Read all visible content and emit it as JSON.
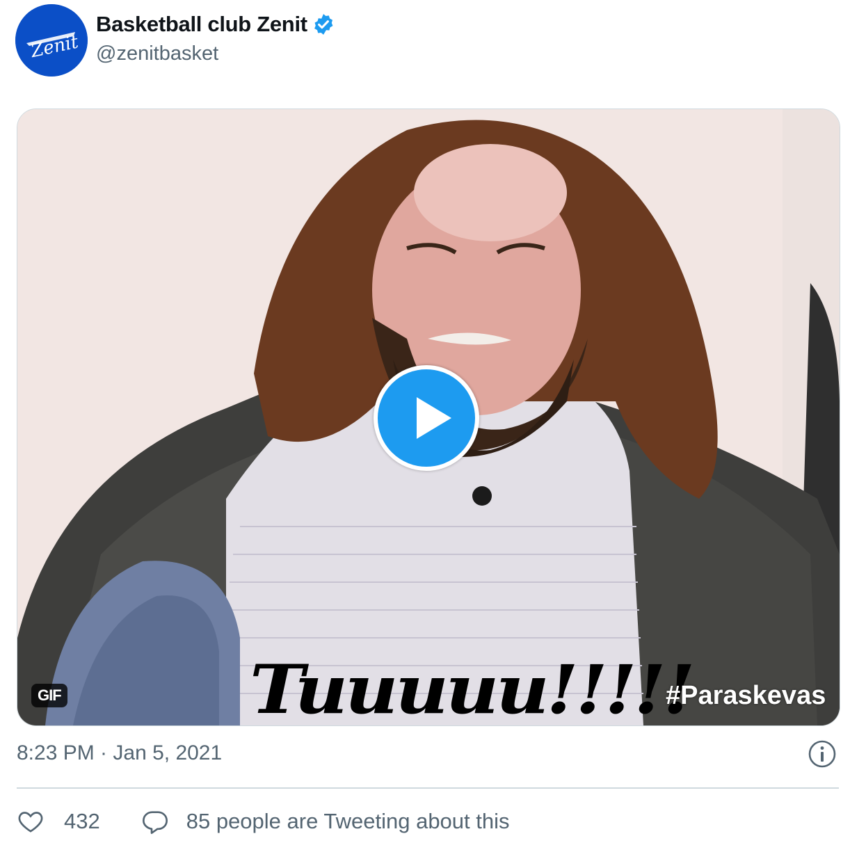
{
  "account": {
    "display_name": "Basketball club Zenit",
    "handle": "@zenitbasket",
    "avatar_text": "Zenit",
    "verified": true
  },
  "media": {
    "badge": "GIF",
    "caption": "Tuuuuu!!!!!",
    "watermark": "#Paraskevas",
    "play_button": "play-icon"
  },
  "meta": {
    "timestamp": "8:23 PM · Jan 5, 2021"
  },
  "engagement": {
    "likes": "432",
    "replies_text": "85 people are Tweeting about this"
  },
  "colors": {
    "accent": "#1d9bf0",
    "avatar_bg": "#0b4fc7",
    "muted_text": "#536471",
    "divider": "#cfd9de"
  }
}
